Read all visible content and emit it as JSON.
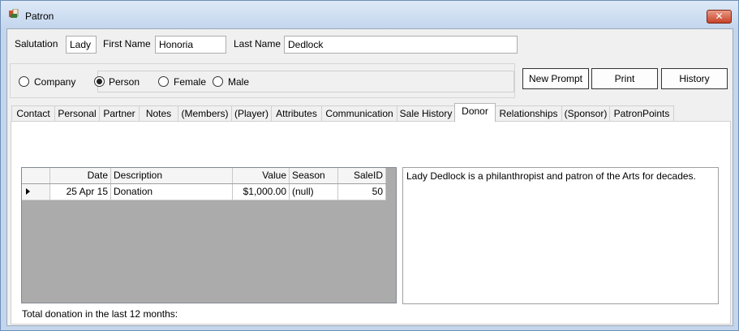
{
  "window": {
    "title": "Patron",
    "close_glyph": "✕"
  },
  "form": {
    "salutation": {
      "label": "Salutation",
      "value": "Lady"
    },
    "first_name": {
      "label": "First Name",
      "value": "Honoria"
    },
    "last_name": {
      "label": "Last Name",
      "value": "Dedlock"
    }
  },
  "radios": {
    "company": {
      "label": "Company",
      "checked": false
    },
    "person": {
      "label": "Person",
      "checked": true
    },
    "female": {
      "label": "Female",
      "checked": false
    },
    "male": {
      "label": "Male",
      "checked": false
    }
  },
  "buttons": {
    "new_prompt": "New Prompt",
    "print": "Print",
    "history": "History"
  },
  "tabs": [
    {
      "label": "Contact"
    },
    {
      "label": "Personal"
    },
    {
      "label": "Partner"
    },
    {
      "label": "Notes"
    },
    {
      "label": "(Members)"
    },
    {
      "label": "(Player)"
    },
    {
      "label": "Attributes"
    },
    {
      "label": "Communication"
    },
    {
      "label": "Sale History"
    },
    {
      "label": "Donor",
      "active": true
    },
    {
      "label": "Relationships"
    },
    {
      "label": "(Sponsor)"
    },
    {
      "label": "PatronPoints"
    }
  ],
  "donor": {
    "grid": {
      "columns": [
        "Date",
        "Description",
        "Value",
        "Season",
        "SaleID"
      ],
      "rows": [
        {
          "date": "25 Apr 15",
          "description": "Donation",
          "value": "$1,000.00",
          "season": "(null)",
          "sale_id": "50"
        }
      ]
    },
    "notes": "Lady Dedlock is a philanthropist and patron of the Arts for decades.",
    "total_label": "Total donation in the last 12 months:"
  },
  "colors": {
    "title_bar": "#c5d7ee",
    "close_button": "#c7432a",
    "grid_empty": "#ababab"
  },
  "icons": {
    "app": "patron-app-icon",
    "row_indicator": "current-row-arrow-icon"
  }
}
